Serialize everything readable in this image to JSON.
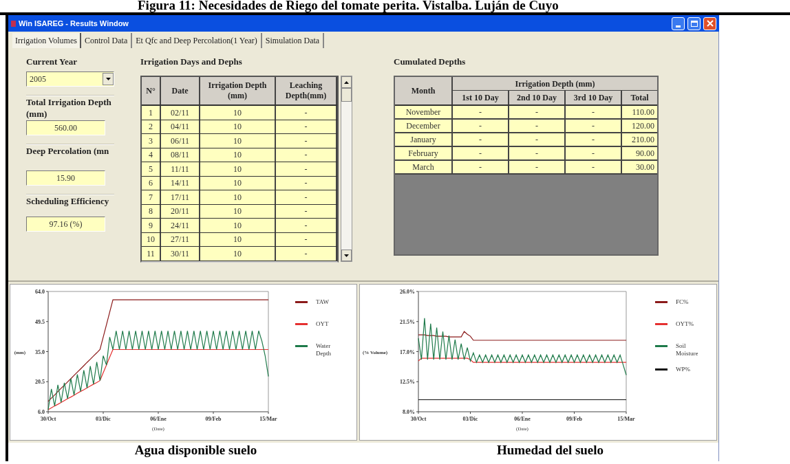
{
  "caption_top": "Figura 11: Necesidades de Riego del tomate perita. Vistalba. Luján de Cuyo",
  "window": {
    "title": "Win ISAREG - Results Window"
  },
  "tabs": [
    {
      "label": "Irrigation Volumes",
      "selected": true
    },
    {
      "label": "Control Data",
      "selected": false
    },
    {
      "label": "Et Qfc and Deep Percolation(1 Year)",
      "selected": false
    },
    {
      "label": "Simulation Data",
      "selected": false
    }
  ],
  "current_year": {
    "label": "Current Year",
    "value": "2005"
  },
  "summary_fields": [
    {
      "label": "Total Irrigation Depth (mm)",
      "value": "560.00"
    },
    {
      "label": "Deep Percolation (mn",
      "value": "15.90"
    },
    {
      "label": "Scheduling Efficiency",
      "value": "97.16 (%)"
    }
  ],
  "irrigation_table": {
    "title": "Irrigation Days and Dephs",
    "columns": [
      "N°",
      "Date",
      "Irrigation Depth (mm)",
      "Leaching Depth(mm)"
    ],
    "rows": [
      [
        "1",
        "02/11",
        "10",
        "-"
      ],
      [
        "2",
        "04/11",
        "10",
        "-"
      ],
      [
        "3",
        "06/11",
        "10",
        "-"
      ],
      [
        "4",
        "08/11",
        "10",
        "-"
      ],
      [
        "5",
        "11/11",
        "10",
        "-"
      ],
      [
        "6",
        "14/11",
        "10",
        "-"
      ],
      [
        "7",
        "17/11",
        "10",
        "-"
      ],
      [
        "8",
        "20/11",
        "10",
        "-"
      ],
      [
        "9",
        "24/11",
        "10",
        "-"
      ],
      [
        "10",
        "27/11",
        "10",
        "-"
      ],
      [
        "11",
        "30/11",
        "10",
        "-"
      ]
    ]
  },
  "cumulated_table": {
    "title": "Cumulated Depths",
    "group_header": "Irrigation Depth (mm)",
    "columns": [
      "Month",
      "1st 10 Day",
      "2nd 10 Day",
      "3rd 10 Day",
      "Total"
    ],
    "rows": [
      [
        "November",
        "-",
        "-",
        "-",
        "110.00"
      ],
      [
        "December",
        "-",
        "-",
        "-",
        "120.00"
      ],
      [
        "January",
        "-",
        "-",
        "-",
        "210.00"
      ],
      [
        "February",
        "-",
        "-",
        "-",
        "90.00"
      ],
      [
        "March",
        "-",
        "-",
        "-",
        "30.00"
      ]
    ]
  },
  "charts": [
    {
      "caption": "Agua disponible suelo",
      "chart_data": {
        "type": "line",
        "xlabel": "(Date)",
        "ylabel": "(mm)",
        "legend": "right",
        "categories": [
          "30/Oct",
          null,
          null,
          null,
          null,
          null,
          null,
          null,
          null,
          null,
          null,
          null,
          null,
          null,
          null,
          null,
          null,
          "03/Dic",
          null,
          null,
          null,
          null,
          null,
          null,
          null,
          null,
          null,
          null,
          null,
          null,
          null,
          null,
          null,
          null,
          "06/Ene",
          null,
          null,
          null,
          null,
          null,
          null,
          null,
          null,
          null,
          null,
          null,
          null,
          null,
          null,
          null,
          null,
          "09/Feb",
          null,
          null,
          null,
          null,
          null,
          null,
          null,
          null,
          null,
          null,
          null,
          null,
          null,
          null,
          null,
          null,
          "15/Mar"
        ],
        "ylim": [
          6,
          64
        ],
        "yticks": [
          {
            "value": 64,
            "label": "64.0"
          },
          {
            "value": 49.5,
            "label": "49.5"
          },
          {
            "value": 35,
            "label": "35.0"
          },
          {
            "value": 20.5,
            "label": "20.5"
          },
          {
            "value": 6,
            "label": "6.0"
          }
        ],
        "series": [
          {
            "name": "TAW",
            "color": "#8b1a1a",
            "values": [
              11,
              12.6,
              14.1,
              15.7,
              17.3,
              18.8,
              20.4,
              21.9,
              23.5,
              25.1,
              26.6,
              28.2,
              29.8,
              31.3,
              32.9,
              34.4,
              36,
              42,
              48,
              54,
              60,
              60,
              60,
              60,
              60,
              60,
              60,
              60,
              60,
              60,
              60,
              60,
              60,
              60,
              60,
              60,
              60,
              60,
              60,
              60,
              60,
              60,
              60,
              60,
              60,
              60,
              60,
              60,
              60,
              60,
              60,
              60,
              60,
              60,
              60,
              60,
              60,
              60,
              60,
              60,
              60,
              60,
              60,
              60,
              60,
              60,
              60,
              60,
              60
            ]
          },
          {
            "name": "OYT",
            "color": "#e53030",
            "values": [
              7,
              7.9,
              8.8,
              9.6,
              10.5,
              11.4,
              12.3,
              13.1,
              14,
              14.9,
              15.8,
              16.6,
              17.5,
              18.4,
              19.3,
              20.1,
              21,
              24.8,
              28.5,
              32.3,
              36,
              36,
              36,
              36,
              36,
              36,
              36,
              36,
              36,
              36,
              36,
              36,
              36,
              36,
              36,
              36,
              36,
              36,
              36,
              36,
              36,
              36,
              36,
              36,
              36,
              36,
              36,
              36,
              36,
              36,
              36,
              36,
              36,
              36,
              36,
              36,
              36,
              36,
              36,
              36,
              36,
              36,
              36,
              36,
              36,
              36,
              36,
              36,
              36
            ]
          },
          {
            "name": "Water Depth",
            "color": "#1e7a4a",
            "values": [
              7,
              17,
              8.8,
              19,
              10.5,
              20,
              12.3,
              22,
              14,
              24,
              15.8,
              26,
              17.5,
              28,
              19.3,
              30,
              21,
              33,
              28.5,
              42,
              36,
              45,
              36,
              45,
              36,
              45,
              36,
              45,
              36,
              45,
              36,
              45,
              36,
              45,
              36,
              45,
              36,
              45,
              36,
              45,
              36,
              45,
              36,
              45,
              36,
              45,
              36,
              45,
              36,
              45,
              36,
              45,
              36,
              45,
              36,
              45,
              36,
              45,
              36,
              45,
              36,
              45,
              36,
              45,
              36,
              45,
              40,
              33,
              23
            ]
          }
        ]
      }
    },
    {
      "caption": "Humedad del suelo",
      "chart_data": {
        "type": "line",
        "xlabel": "(Date)",
        "ylabel": "(% Volume)",
        "legend": "right",
        "categories": [
          "30/Oct",
          null,
          null,
          null,
          null,
          null,
          null,
          null,
          null,
          null,
          null,
          null,
          null,
          null,
          null,
          null,
          null,
          "03/Dic",
          null,
          null,
          null,
          null,
          null,
          null,
          null,
          null,
          null,
          null,
          null,
          null,
          null,
          null,
          null,
          null,
          "06/Ene",
          null,
          null,
          null,
          null,
          null,
          null,
          null,
          null,
          null,
          null,
          null,
          null,
          null,
          null,
          null,
          null,
          "09/Feb",
          null,
          null,
          null,
          null,
          null,
          null,
          null,
          null,
          null,
          null,
          null,
          null,
          null,
          null,
          null,
          null,
          "15/Mar"
        ],
        "ylim": [
          8,
          26
        ],
        "yticks": [
          {
            "value": 26,
            "label": "26.0%"
          },
          {
            "value": 21.5,
            "label": "21.5%"
          },
          {
            "value": 17,
            "label": "17.0%"
          },
          {
            "value": 12.5,
            "label": "12.5%"
          },
          {
            "value": 8,
            "label": "8.0%"
          }
        ],
        "series": [
          {
            "name": "FC%",
            "color": "#8b1a1a",
            "values": [
              19.5,
              19.5,
              19.5,
              19.4,
              19.4,
              19.4,
              19.3,
              19.3,
              19.3,
              19.3,
              19.2,
              19.2,
              19.2,
              19.2,
              19.2,
              20,
              19.6,
              19.3,
              18.7,
              18.7,
              18.7,
              18.7,
              18.7,
              18.7,
              18.7,
              18.7,
              18.7,
              18.7,
              18.7,
              18.7,
              18.7,
              18.7,
              18.7,
              18.7,
              18.7,
              18.7,
              18.7,
              18.7,
              18.7,
              18.7,
              18.7,
              18.7,
              18.7,
              18.7,
              18.7,
              18.7,
              18.7,
              18.7,
              18.7,
              18.7,
              18.7,
              18.7,
              18.7,
              18.7,
              18.7,
              18.7,
              18.7,
              18.7,
              18.7,
              18.7,
              18.7,
              18.7,
              18.7,
              18.7,
              18.7,
              18.7,
              18.7,
              18.7,
              18.7
            ]
          },
          {
            "name": "OYT%",
            "color": "#e53030",
            "values": [
              15.6,
              16,
              16,
              16,
              16,
              16,
              16,
              16,
              16,
              16,
              16,
              16,
              16,
              16,
              16,
              16,
              16,
              15.8,
              15.4,
              15.4,
              15.4,
              15.4,
              15.4,
              15.4,
              15.4,
              15.4,
              15.4,
              15.4,
              15.4,
              15.4,
              15.4,
              15.4,
              15.4,
              15.4,
              15.4,
              15.4,
              15.4,
              15.4,
              15.4,
              15.4,
              15.4,
              15.4,
              15.4,
              15.4,
              15.4,
              15.4,
              15.4,
              15.4,
              15.4,
              15.4,
              15.4,
              15.4,
              15.4,
              15.4,
              15.4,
              15.4,
              15.4,
              15.4,
              15.4,
              15.4,
              15.4,
              15.4,
              15.4,
              15.4,
              15.4,
              15.4,
              15.4,
              15.4,
              15.4
            ]
          },
          {
            "name": "Soil Moisture",
            "color": "#1e7a4a",
            "values": [
              19,
              15.8,
              22,
              15.8,
              21.2,
              15.8,
              20.6,
              15.8,
              20,
              15.8,
              19.4,
              15.8,
              18.8,
              15.8,
              18.2,
              15.8,
              17.6,
              15.6,
              16.8,
              15.4,
              16.5,
              15.4,
              16.5,
              15.4,
              16.5,
              15.4,
              16.5,
              15.4,
              16.5,
              15.4,
              16.5,
              15.4,
              16.5,
              15.4,
              16.5,
              15.4,
              16.5,
              15.4,
              16.5,
              15.4,
              16.5,
              15.4,
              16.5,
              15.4,
              16.5,
              15.4,
              16.5,
              15.4,
              16.5,
              15.4,
              16.5,
              15.4,
              16.5,
              15.4,
              16.5,
              15.4,
              16.5,
              15.4,
              16.5,
              15.4,
              16.5,
              15.4,
              16.5,
              15.4,
              16.5,
              15.4,
              16.5,
              15,
              13.5
            ]
          },
          {
            "name": "WP%",
            "color": "#111111",
            "values": [
              9.8,
              9.8,
              9.8,
              9.8,
              9.8,
              9.8,
              9.8,
              9.8,
              9.8,
              9.8,
              9.8,
              9.8,
              9.8,
              9.8,
              9.8,
              9.8,
              9.8,
              9.8,
              9.8,
              9.8,
              9.8,
              9.8,
              9.8,
              9.8,
              9.8,
              9.8,
              9.8,
              9.8,
              9.8,
              9.8,
              9.8,
              9.8,
              9.8,
              9.8,
              9.8,
              9.8,
              9.8,
              9.8,
              9.8,
              9.8,
              9.8,
              9.8,
              9.8,
              9.8,
              9.8,
              9.8,
              9.8,
              9.8,
              9.8,
              9.8,
              9.8,
              9.8,
              9.8,
              9.8,
              9.8,
              9.8,
              9.8,
              9.8,
              9.8,
              9.8,
              9.8,
              9.8,
              9.8,
              9.8,
              9.8,
              9.8,
              9.8,
              9.8,
              9.8
            ]
          }
        ]
      }
    }
  ]
}
